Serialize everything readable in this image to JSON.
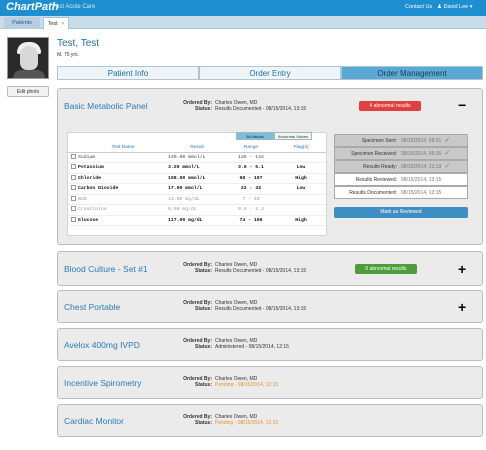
{
  "app": {
    "name": "ChartPath",
    "subtitle": "Post Acute Care"
  },
  "topbar": {
    "contact": "Contact Us",
    "user": "David Lee"
  },
  "tabs": [
    {
      "label": "Patients"
    },
    {
      "label": "Test",
      "close": "×"
    }
  ],
  "patient": {
    "name": "Test, Test",
    "info": "M, 75 yrs."
  },
  "edit_photo_label": "Edit photo",
  "nav_tabs": [
    {
      "label": "Patient Info"
    },
    {
      "label": "Order Entry"
    },
    {
      "label": "Order Management"
    }
  ],
  "labels": {
    "ordered_by": "Ordered By:",
    "status": "Status:"
  },
  "orders": [
    {
      "title": "Basic Metabolic Panel",
      "ordered_by": "Charles Owen, MD",
      "status": "Results Documented - 08/15/2014, 13:15",
      "badge": "4 abnormal results",
      "toggle": "−"
    },
    {
      "title": "Blood Culture - Set #1",
      "ordered_by": "Charles Owen, MD",
      "status": "Results Documented - 08/15/2014, 13:15",
      "badge": "0 abnormal results",
      "toggle": "+"
    },
    {
      "title": "Chest Portable",
      "ordered_by": "Charles Owen, MD",
      "status": "Results Documented - 08/15/2014, 13:15",
      "toggle": "+"
    },
    {
      "title": "Avelox 400mg IVPD",
      "ordered_by": "Charles Owen, MD",
      "status": "Administered - 08/15/2014, 12:15"
    },
    {
      "title": "Incentive Spirometry",
      "ordered_by": "Charles Owen, MD",
      "status": "Pending - 08/15/2014, 12:15"
    },
    {
      "title": "Cardiac Monitor",
      "ordered_by": "Charles Owen, MD",
      "status": "Pending - 08/15/2014, 12:15"
    }
  ],
  "results": {
    "toggles": {
      "all": "All Values",
      "abnormal": "Abnormal Values"
    },
    "headers": {
      "test": "Test Name",
      "result": "Result",
      "range": "Range",
      "flag": "Flag(s)"
    },
    "rows": [
      {
        "test": "Sodium",
        "result": "140.00 mmol/L",
        "range": "136 - 144",
        "flag": ""
      },
      {
        "test": "Potassium",
        "result": "3.20 mmol/L",
        "range": "3.6 - 5.1",
        "flag": "Low"
      },
      {
        "test": "Chloride",
        "result": "108.00 mmol/L",
        "range": "98 - 107",
        "flag": "High"
      },
      {
        "test": "Carbon Dioxide",
        "result": "17.00 mmol/L",
        "range": "22 - 32",
        "flag": "Low"
      },
      {
        "test": "BUN",
        "result": "13.00 mg/dL",
        "range": "7 - 19",
        "flag": ""
      },
      {
        "test": "Creatinine",
        "result": "0.90 mg/dL",
        "range": "0.9 - 1.3",
        "flag": ""
      },
      {
        "test": "Glucose",
        "result": "117.00 mg/dL",
        "range": "74 - 106",
        "flag": "High"
      }
    ]
  },
  "status_tracker": [
    {
      "label": "Specimen Sent:",
      "value": "08/15/2014, 09:21",
      "done": true
    },
    {
      "label": "Specimen Received:",
      "value": "08/15/2014, 09:36",
      "done": true
    },
    {
      "label": "Results Ready:",
      "value": "08/15/2014, 13:13",
      "done": true
    },
    {
      "label": "Results Reviewed:",
      "value": "08/15/2014, 13:15",
      "done": false
    },
    {
      "label": "Results Documented:",
      "value": "08/15/2014, 13:15",
      "done": false
    }
  ],
  "mark_reviewed_label": "Mark as Reviewed",
  "colors": {
    "brand": "#1d8fd0",
    "abnormal": "#e2403e",
    "normal": "#4d9e3b",
    "pending": "#e8912c"
  }
}
